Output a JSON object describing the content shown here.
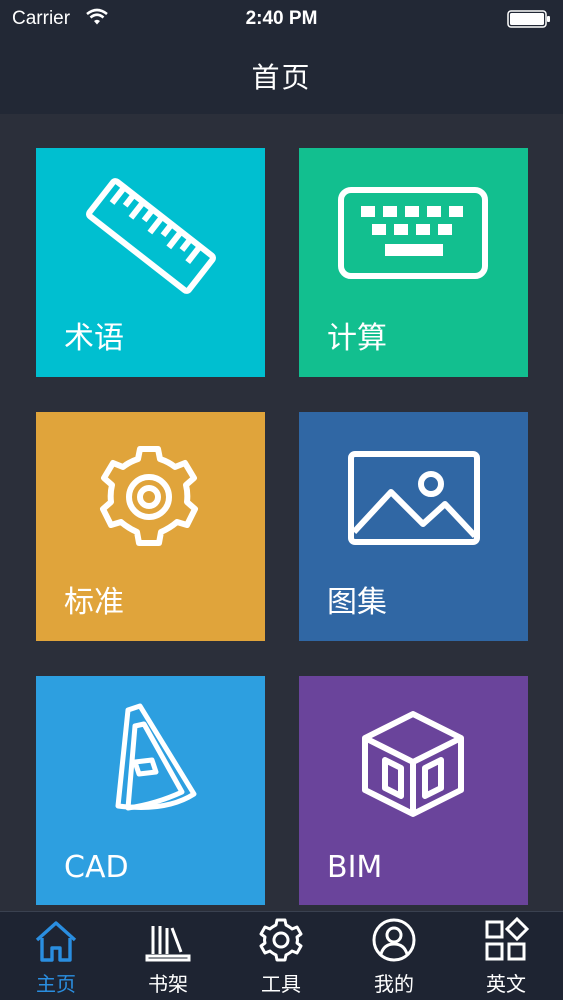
{
  "status_bar": {
    "carrier": "Carrier",
    "time": "2:40 PM",
    "wifi_icon": "wifi-icon",
    "battery_icon": "battery-icon"
  },
  "nav": {
    "title": "首页"
  },
  "tiles": [
    {
      "label": "术语",
      "icon": "ruler-icon",
      "color": "#00bfd0"
    },
    {
      "label": "计算",
      "icon": "keyboard-icon",
      "color": "#12bf8f"
    },
    {
      "label": "标准",
      "icon": "gear-icon",
      "color": "#e0a43b"
    },
    {
      "label": "图集",
      "icon": "image-icon",
      "color": "#3067a4"
    },
    {
      "label": "CAD",
      "icon": "cad-letter-icon",
      "color": "#2d9fe0"
    },
    {
      "label": "BIM",
      "icon": "cube-icon",
      "color": "#6a449b"
    }
  ],
  "tabbar": {
    "active_color": "#2a8ee0",
    "tabs": [
      {
        "label": "主页",
        "icon": "home-icon",
        "active": true
      },
      {
        "label": "书架",
        "icon": "bookshelf-icon",
        "active": false
      },
      {
        "label": "工具",
        "icon": "gear-icon",
        "active": false
      },
      {
        "label": "我的",
        "icon": "user-icon",
        "active": false
      },
      {
        "label": "英文",
        "icon": "apps-icon",
        "active": false
      }
    ]
  }
}
